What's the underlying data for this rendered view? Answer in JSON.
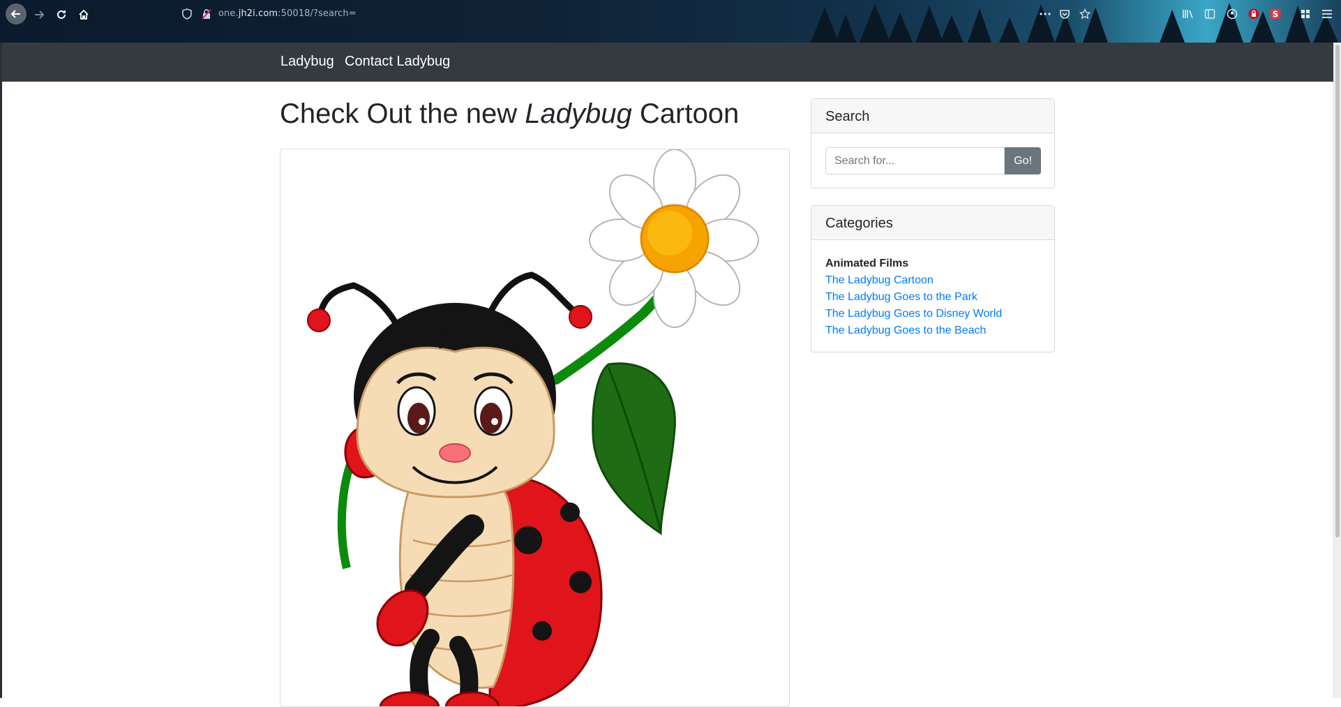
{
  "browser": {
    "url_prefix": "one.",
    "url_host": "jh2i.com",
    "url_suffix": ":50018/?search="
  },
  "navbar": {
    "brand": "Ladybug",
    "links": [
      {
        "label": "Contact Ladybug"
      }
    ]
  },
  "main": {
    "title_before": "Check Out the new ",
    "title_emphasis": "Ladybug",
    "title_after": " Cartoon",
    "hero_image": "ladybug-cartoon-holding-daisy"
  },
  "sidebar": {
    "search": {
      "header": "Search",
      "placeholder": "Search for...",
      "value": "",
      "button_label": "Go!"
    },
    "categories": {
      "header": "Categories",
      "group_heading": "Animated Films",
      "items": [
        {
          "label": "The Ladybug Cartoon"
        },
        {
          "label": "The Ladybug Goes to the Park"
        },
        {
          "label": "The Ladybug Goes to Disney World"
        },
        {
          "label": "The Ladybug Goes to the Beach"
        }
      ]
    }
  },
  "colors": {
    "navbar_bg": "#343a40",
    "link": "#007bff",
    "button_secondary": "#6c757d"
  }
}
